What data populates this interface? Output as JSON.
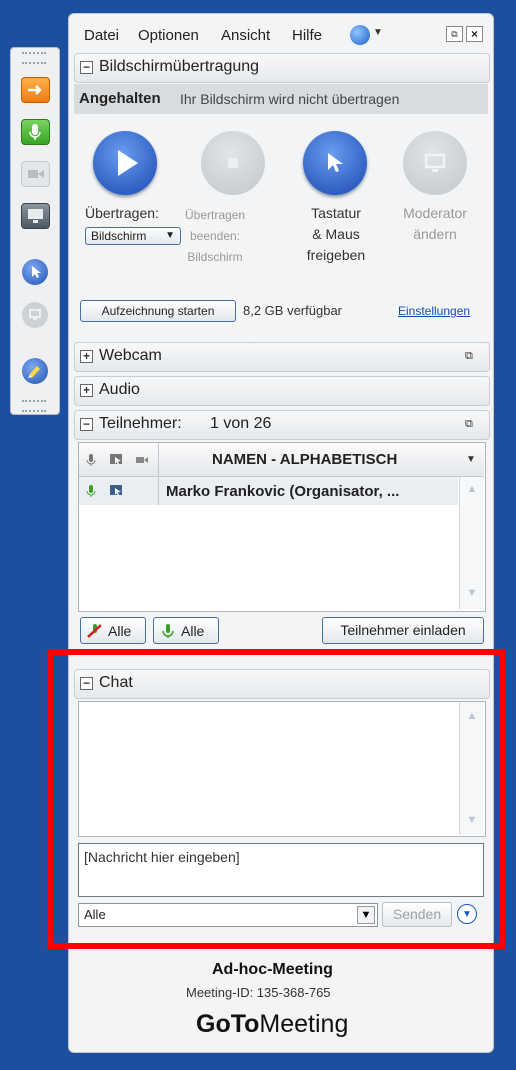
{
  "menu": {
    "items": [
      "Datei",
      "Optionen",
      "Ansicht",
      "Hilfe"
    ]
  },
  "sharing": {
    "title": "Bildschirmübertragung",
    "status_bold": "Angehalten",
    "status_text": "Ihr Bildschirm wird nicht übertragen",
    "start_label": "Übertragen:",
    "screen_select": "Bildschirm",
    "stop_line1": "Übertragen",
    "stop_line2": "beenden:",
    "stop_line3": "Bildschirm",
    "keyboard_line1": "Tastatur",
    "keyboard_line2": "& Maus",
    "keyboard_line3": "freigeben",
    "presenter_line1": "Moderator",
    "presenter_line2": "ändern",
    "record_button": "Aufzeichnung starten",
    "space_text": "8,2 GB verfügbar",
    "settings_link": "Einstellungen"
  },
  "webcam": {
    "title": "Webcam"
  },
  "audio": {
    "title": "Audio"
  },
  "attendees": {
    "title": "Teilnehmer:",
    "count": "1 von 26",
    "column_header": "NAMEN - ALPHABETISCH",
    "rows": [
      {
        "name": "Marko Frankovic (Organisator, ..."
      }
    ],
    "mute_all_label": "Alle",
    "unmute_all_label": "Alle",
    "invite_button": "Teilnehmer einladen"
  },
  "chat": {
    "title": "Chat",
    "input_placeholder": "[Nachricht hier eingeben]",
    "recipient_value": "Alle",
    "send_button": "Senden"
  },
  "footer": {
    "meeting_title": "Ad-hoc-Meeting",
    "meeting_id": "Meeting-ID: 135-368-765",
    "logo_bold": "GoTo",
    "logo_light": "Meeting"
  },
  "colors": {
    "accent": "#1a56c4",
    "highlight": "#ff0000",
    "background": "#1d4fa0"
  }
}
